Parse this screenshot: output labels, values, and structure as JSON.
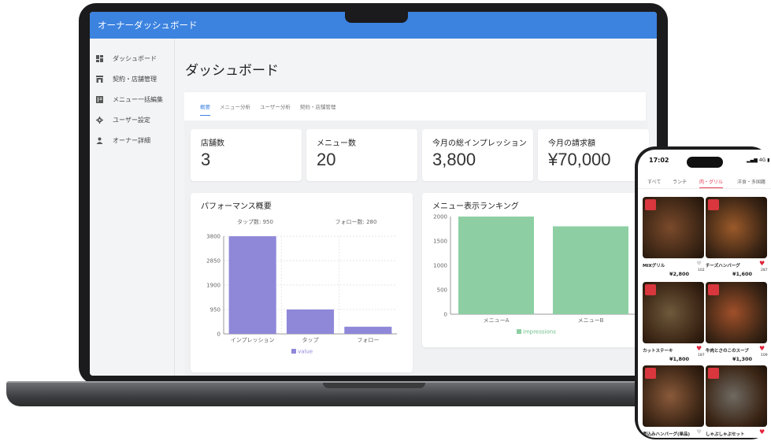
{
  "app": {
    "title": "オーナーダッシュボード",
    "sidebar": [
      {
        "label": "ダッシュボード",
        "icon": "dashboard-icon"
      },
      {
        "label": "契約・店舗管理",
        "icon": "store-icon"
      },
      {
        "label": "メニュー一括編集",
        "icon": "menu-book-icon"
      },
      {
        "label": "ユーザー設定",
        "icon": "gear-icon"
      },
      {
        "label": "オーナー詳細",
        "icon": "person-icon"
      }
    ],
    "page_title": "ダッシュボード",
    "tabs": [
      "概要",
      "メニュー分析",
      "ユーザー分析",
      "契約・店舗管理"
    ],
    "active_tab": "概要",
    "stats": [
      {
        "label": "店舗数",
        "value": "3"
      },
      {
        "label": "メニュー数",
        "value": "20"
      },
      {
        "label": "今月の総インプレッション",
        "value": "3,800"
      },
      {
        "label": "今月の請求額",
        "value": "¥70,000"
      }
    ],
    "colors": {
      "appbar": "#3c83e0",
      "bar_purple": "#8f88d9",
      "bar_green": "#8dcfa3"
    }
  },
  "chart_data": [
    {
      "type": "bar",
      "title": "パフォーマンス概要",
      "categories": [
        "インプレッション",
        "タップ",
        "フォロー"
      ],
      "series": [
        {
          "name": "value",
          "values": [
            3800,
            950,
            280
          ]
        }
      ],
      "ylim": [
        0,
        3800
      ],
      "yticks": [
        "0",
        "950",
        "1900",
        "2850",
        "3800"
      ],
      "annotations": [
        "タップ数: 950",
        "フォロー数: 280"
      ],
      "legend": "bottom",
      "grid": true
    },
    {
      "type": "bar",
      "title": "メニュー表示ランキング",
      "categories": [
        "メニューA",
        "メニューB"
      ],
      "series": [
        {
          "name": "impressions",
          "values": [
            2000,
            1800
          ]
        }
      ],
      "ylim": [
        0,
        2000
      ],
      "yticks": [
        "0",
        "500",
        "1000",
        "1500",
        "2000"
      ],
      "legend": "bottom",
      "grid": false
    }
  ],
  "phone": {
    "time": "17:02",
    "signal": "4G",
    "tabs": [
      "すべて",
      "ランチ",
      "肉・グリル",
      "洋食・多国籍"
    ],
    "active_tab": "肉・グリル",
    "items": [
      {
        "name": "MIXグリル",
        "price": "¥2,800",
        "likes": "102",
        "liked": false,
        "color": "#7a4a2b"
      },
      {
        "name": "チーズハンバーグ",
        "price": "¥1,600",
        "likes": "287",
        "liked": true,
        "color": "#9b5a2a"
      },
      {
        "name": "カットステーキ",
        "price": "¥1,800",
        "likes": "187",
        "liked": true,
        "color": "#6e5a3c"
      },
      {
        "name": "牛肉とさのこのスープ",
        "price": "¥1,300",
        "likes": "109",
        "liked": true,
        "color": "#a0502a"
      },
      {
        "name": "煮込みハンバーグ(単品)",
        "price": "",
        "likes": "",
        "liked": false,
        "color": "#8a5a3a"
      },
      {
        "name": "しゃぶしゃぶセット",
        "price": "",
        "likes": "",
        "liked": true,
        "color": "#6f6a62"
      }
    ]
  }
}
